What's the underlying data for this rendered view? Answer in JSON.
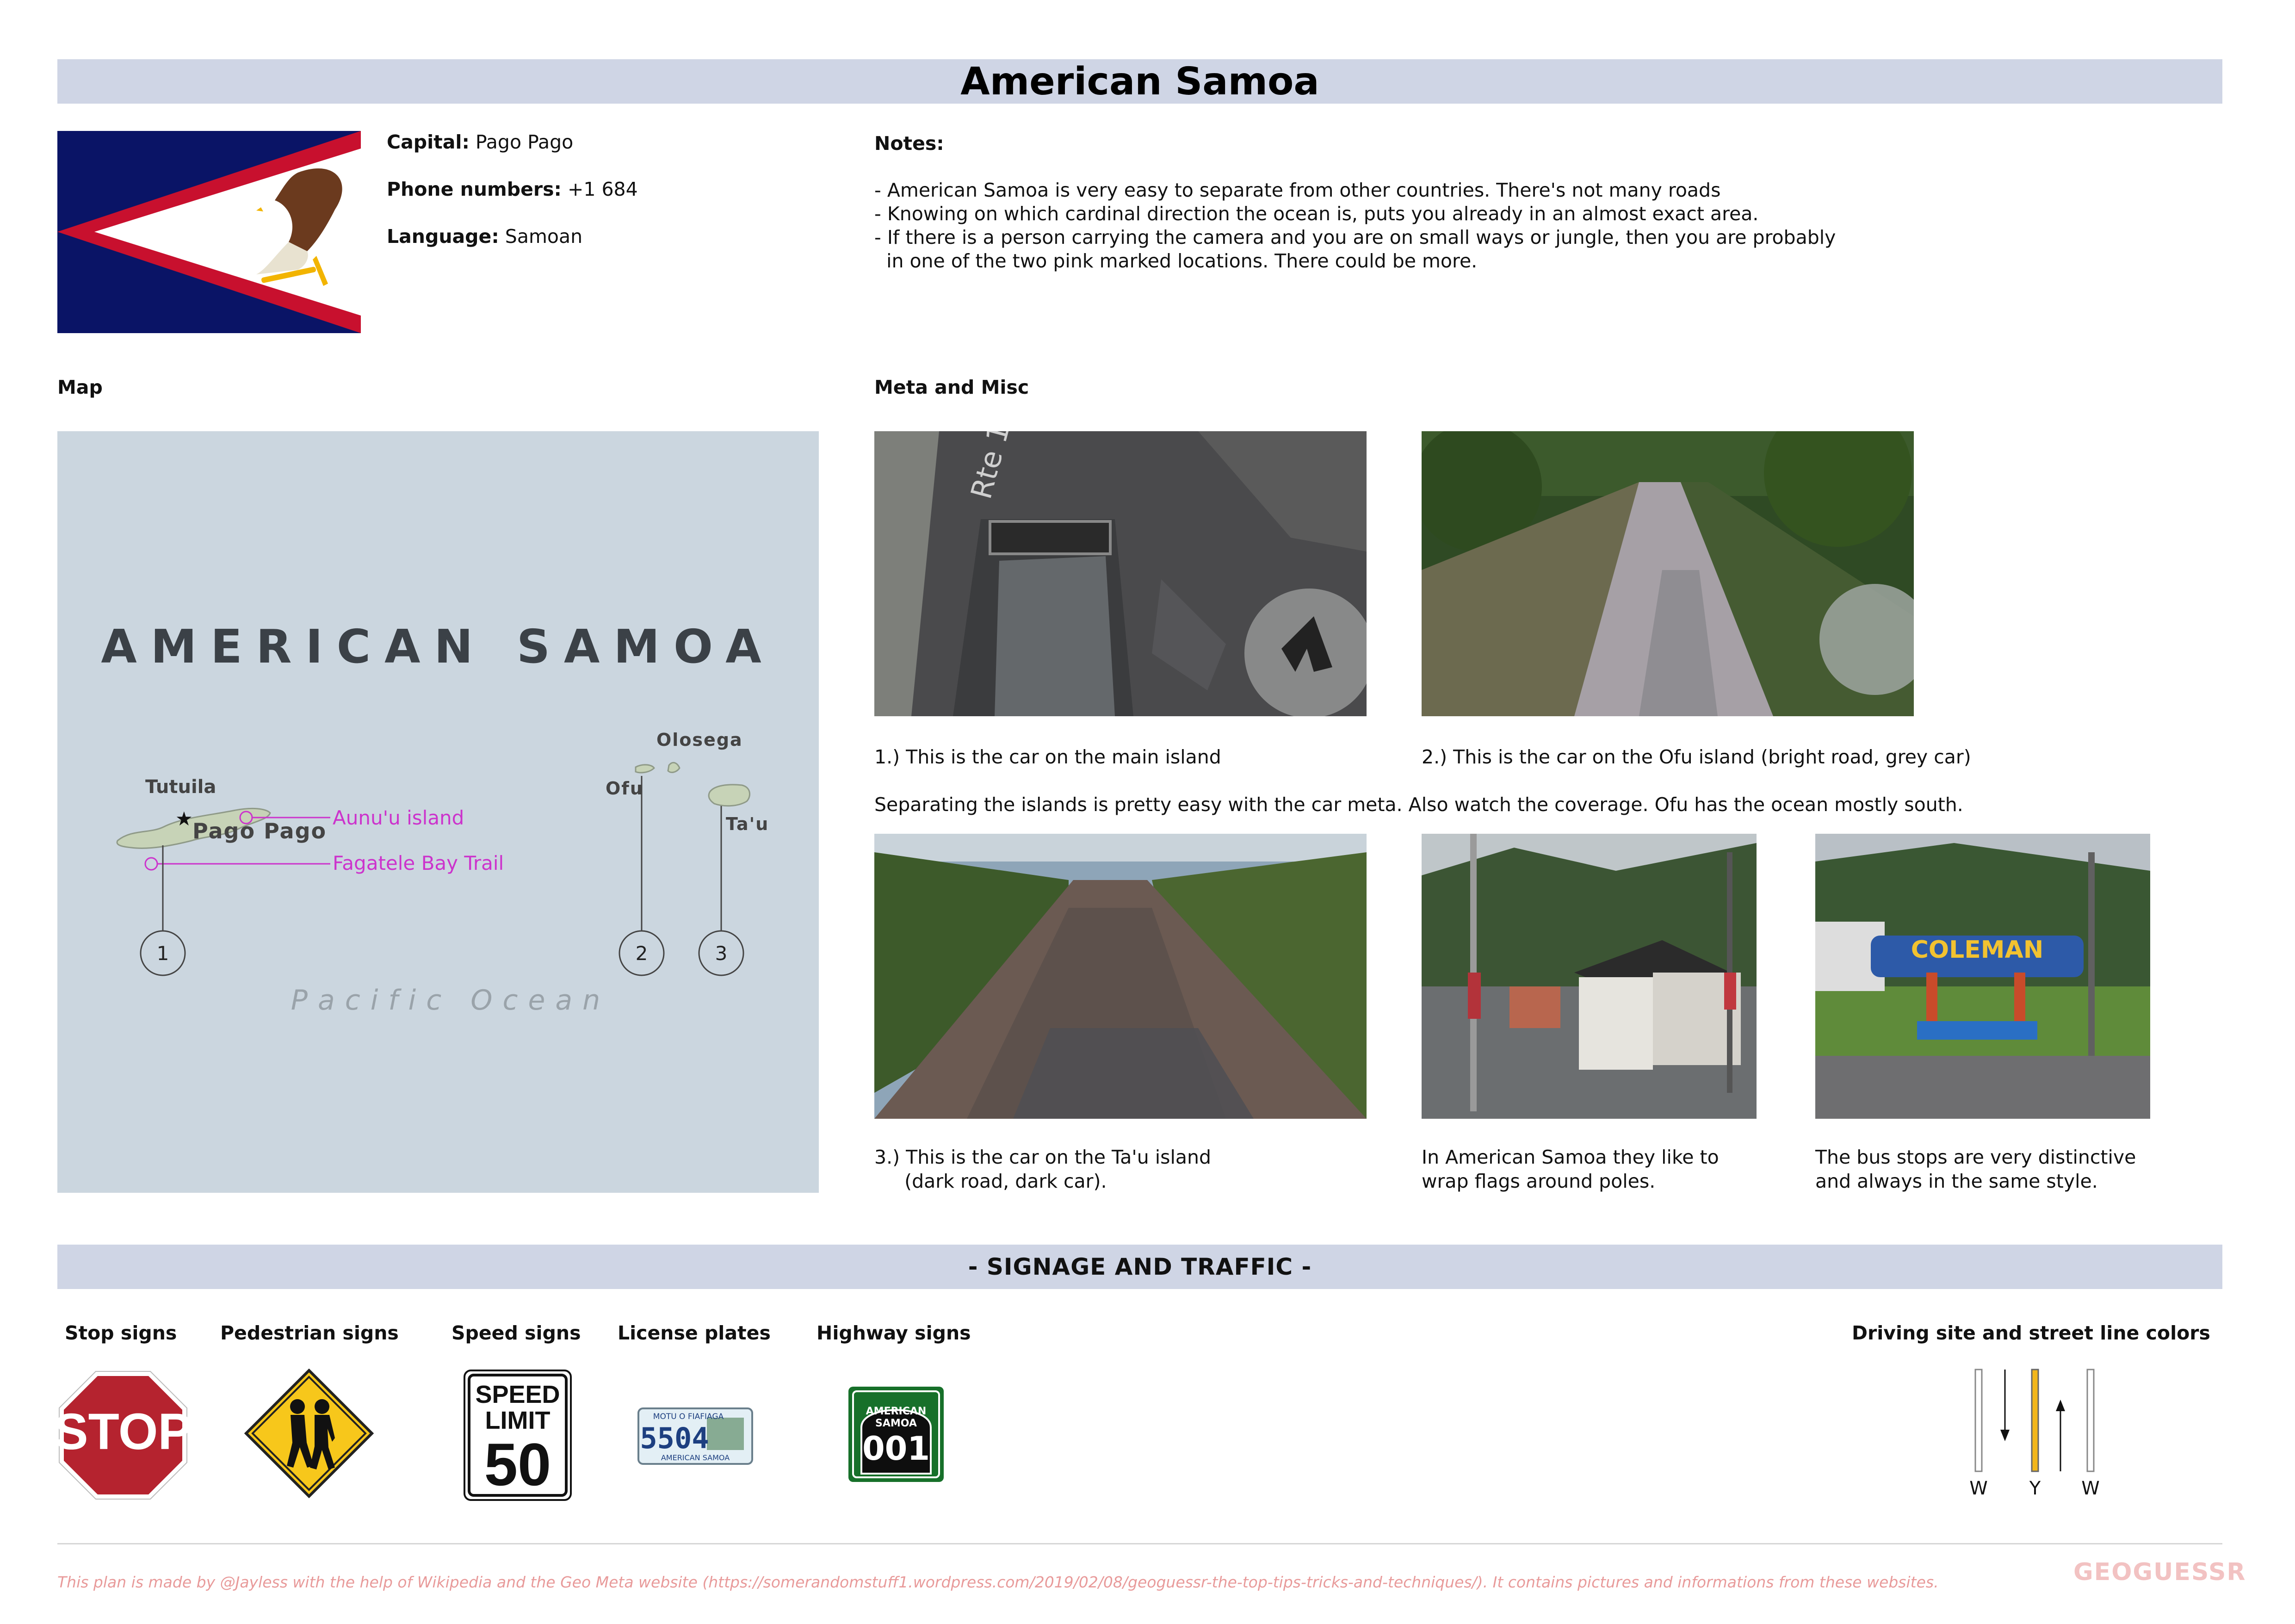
{
  "header": {
    "title": "American Samoa"
  },
  "facts": {
    "capital_label": "Capital:",
    "capital_value": "Pago Pago",
    "phone_label": "Phone numbers:",
    "phone_value": "+1 684",
    "language_label": "Language:",
    "language_value": "Samoan"
  },
  "notes": {
    "heading": "Notes:",
    "lines": [
      "- American Samoa is very easy to separate from other countries. There's not many roads",
      "- Knowing on which cardinal direction the ocean is, puts you already in an almost exact area.",
      "- If there is a person carrying the camera and you are on small ways or jungle, then you are probably",
      "  in one of the two pink marked locations. There could be more."
    ]
  },
  "map": {
    "heading": "Map",
    "country_label": "AMERICAN SAMOA",
    "ocean_label": "Pacific Ocean",
    "islands": {
      "tutuila": "Tutuila",
      "olosega": "Olosega",
      "ofu": "Ofu",
      "tau": "Ta'u"
    },
    "capital": "Pago Pago",
    "pink_labels": {
      "aunuu": "Aunu'u island",
      "fagatele": "Fagatele Bay Trail"
    },
    "markers": [
      "1",
      "2",
      "3"
    ],
    "pink_color": "#cc33cc"
  },
  "meta": {
    "heading": "Meta and Misc",
    "caption1": "1.) This is the car on the main island",
    "caption2": "2.) This is the car on the Ofu island (bright road, grey car)",
    "separator": "Separating the islands is pretty easy with the car meta. Also watch the coverage. Ofu has the ocean mostly south.",
    "caption3": "3.) This is the car on the Ta'u island\n     (dark road, dark car).",
    "caption4": "In American Samoa they like to\nwrap flags around poles.",
    "caption5": "The bus stops are very distinctive\nand always in the same style.",
    "photo_labels": {
      "rte": "Rte 1",
      "coleman": "COLEMAN"
    }
  },
  "signage": {
    "banner": "- SIGNAGE AND TRAFFIC -",
    "stop_heading": "Stop signs",
    "pedestrian_heading": "Pedestrian signs",
    "speed_heading": "Speed signs",
    "plates_heading": "License plates",
    "highway_heading": "Highway signs",
    "driving_heading": "Driving site and street line colors",
    "stop_text": "STOP",
    "speed_line1": "SPEED",
    "speed_line2": "LIMIT",
    "speed_value": "50",
    "plate_top": "MOTU O FIAFIAGA",
    "plate_number": "5504",
    "plate_bottom": "AMERICAN SAMOA",
    "highway_line1": "AMERICAN",
    "highway_line2": "SAMOA",
    "highway_number": "001",
    "line_labels": [
      "W",
      "Y",
      "W"
    ]
  },
  "footer": {
    "note": "This plan is made by @Jayless with the help of Wikipedia and the Geo Meta website (https://somerandomstuff1.wordpress.com/2019/02/08/geoguessr-the-top-tips-tricks-and-techniques/). It contains pictures and informations from these websites.",
    "logo": "GEOGUESSR"
  }
}
